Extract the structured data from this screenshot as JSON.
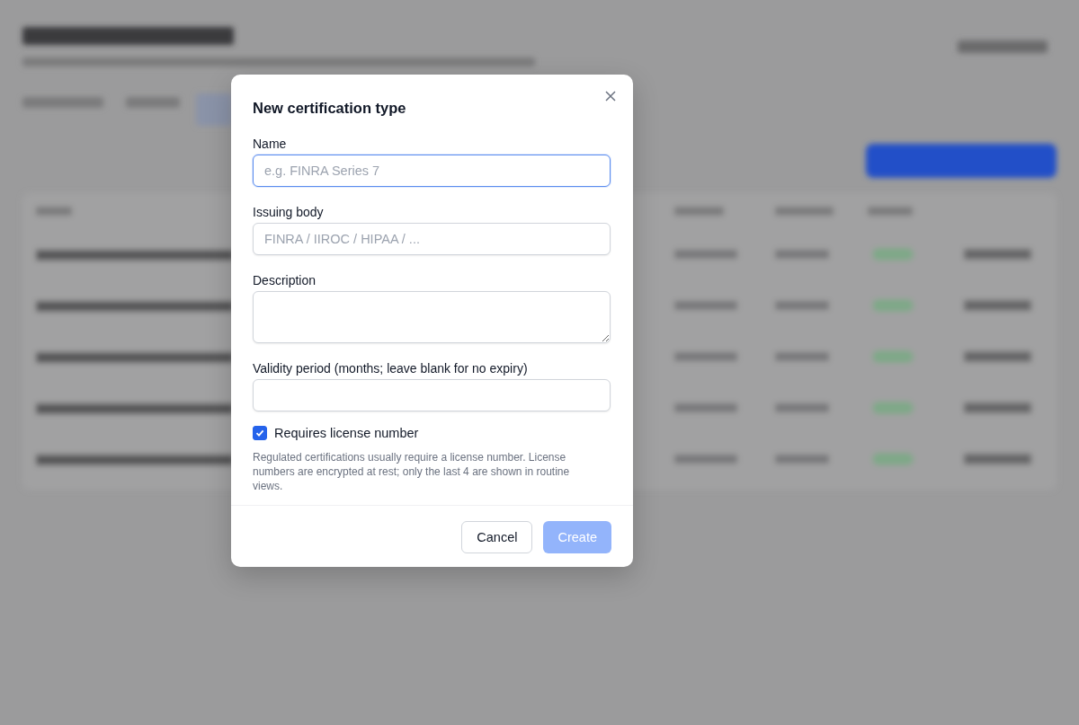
{
  "dialog": {
    "title": "New certification type",
    "fields": [
      {
        "kind": "input",
        "label": "Name",
        "placeholder": "e.g. FINRA Series 7",
        "focused": true
      },
      {
        "kind": "input",
        "label": "Issuing body",
        "placeholder": "FINRA / IIROC / HIPAA / ...",
        "focused": false
      },
      {
        "kind": "textarea",
        "label": "Description",
        "focused": false
      },
      {
        "kind": "input",
        "label": "Validity period (months; leave blank for no expiry)",
        "focused": false
      }
    ],
    "checkbox": {
      "label": "Requires license number",
      "checked": true
    },
    "help": "Regulated certifications usually require a license number. License numbers are encrypted at rest; only the last 4 are shown in routine views.",
    "buttons": [
      {
        "label": "Cancel",
        "kind": "secondary",
        "disabled": false
      },
      {
        "label": "Create",
        "kind": "primary",
        "disabled": true
      }
    ]
  }
}
